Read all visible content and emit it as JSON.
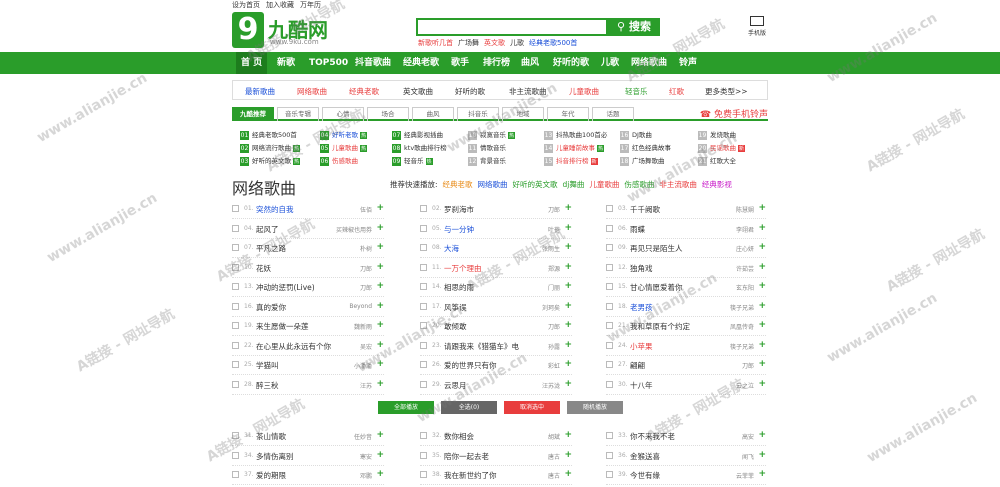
{
  "toplinks": [
    "设为首页",
    "加入收藏",
    "万年历"
  ],
  "logo": {
    "nine": "9",
    "name": "九酷网",
    "domain": "www.9ku.com"
  },
  "search": {
    "button": "搜索"
  },
  "hotwords": [
    "新歌听几首",
    "广场舞",
    "英文歌",
    "儿歌",
    "经典老歌500首"
  ],
  "pc_label": "手机版",
  "nav": [
    "首 页",
    "新歌",
    "TOP500",
    "抖音歌曲",
    "经典老歌",
    "歌手",
    "排行榜",
    "曲风",
    "好听的歌",
    "儿歌",
    "网络歌曲",
    "铃声"
  ],
  "subnav": [
    "最新歌曲",
    "网络歌曲",
    "经典老歌",
    "英文歌曲",
    "好听的歌",
    "非主流歌曲",
    "儿童歌曲",
    "轻音乐",
    "红歌",
    "更多类型>>"
  ],
  "tabs": [
    "九酷推荐",
    "音乐专辑",
    "心情",
    "场合",
    "曲风",
    "抖音乐",
    "地域",
    "年代",
    "话题"
  ],
  "ring": "免费手机铃声",
  "recs": [
    [
      "01",
      "经典老歌500首",
      ""
    ],
    [
      "04",
      "好听老歌",
      "热"
    ],
    [
      "07",
      "经典影视插曲",
      ""
    ],
    [
      "10",
      "寂寞音乐",
      "热"
    ],
    [
      "13",
      "抖热歌曲100首必",
      ""
    ],
    [
      "16",
      "DJ歌曲",
      ""
    ],
    [
      "19",
      "发烧歌曲",
      ""
    ],
    [
      "02",
      "网络流行歌曲",
      "热"
    ],
    [
      "05",
      "儿童歌曲",
      "热"
    ],
    [
      "08",
      "ktv歌曲排行榜",
      ""
    ],
    [
      "11",
      "情歌音乐",
      ""
    ],
    [
      "14",
      "儿童睡前故事",
      "热"
    ],
    [
      "17",
      "红色经典故事",
      ""
    ],
    [
      "20",
      "民谣歌曲",
      "新"
    ],
    [
      "03",
      "好听的英文歌",
      "热"
    ],
    [
      "06",
      "伤感歌曲",
      ""
    ],
    [
      "09",
      "轻音乐",
      "热"
    ],
    [
      "12",
      "背景音乐",
      ""
    ],
    [
      "15",
      "抖音排行榜",
      "新"
    ],
    [
      "18",
      "广场舞歌曲",
      ""
    ],
    [
      "21",
      "红歌大全",
      ""
    ]
  ],
  "section_title": "网络歌曲",
  "quick": [
    "推荐快速播放:",
    "经典老歌",
    "网络歌曲",
    "好听的英文歌",
    "dj舞曲",
    "儿童歌曲",
    "伤感歌曲",
    "非主流歌曲",
    "经典影视"
  ],
  "songs": [
    [
      "01.",
      "突然的自我",
      "伍佰"
    ],
    [
      "02.",
      "罗刹海市",
      "刀郎"
    ],
    [
      "03.",
      "千千阙歌",
      "陈慧娴"
    ],
    [
      "04.",
      "起风了",
      "买辣椒也用券"
    ],
    [
      "05.",
      "与一分钟",
      "叶蓓"
    ],
    [
      "06.",
      "雨蝶",
      "李翊君"
    ],
    [
      "07.",
      "平凡之路",
      "朴树"
    ],
    [
      "08.",
      "大海",
      "张雨生"
    ],
    [
      "09.",
      "再见只是陌生人",
      "庄心妍"
    ],
    [
      "10.",
      "花妖",
      "刀郎"
    ],
    [
      "11.",
      "一万个理由",
      "郑源"
    ],
    [
      "12.",
      "独角戏",
      "许茹芸"
    ],
    [
      "13.",
      "冲动的惩罚(Live)",
      "刀郎"
    ],
    [
      "14.",
      "相思的雨",
      "门丽"
    ],
    [
      "15.",
      "甘心情愿爱着你",
      "玄东阳"
    ],
    [
      "16.",
      "真的爱你",
      "Beyond"
    ],
    [
      "17.",
      "风筝误",
      "刘珂矣"
    ],
    [
      "18.",
      "老男孩",
      "筷子兄弟"
    ],
    [
      "19.",
      "来生愿做一朵莲",
      "魏新雨"
    ],
    [
      "20.",
      "敢倾敢",
      "刀郎"
    ],
    [
      "21.",
      "我和草原有个约定",
      "凤凰传奇"
    ],
    [
      "22.",
      "在心里从此永远有个你",
      "吴宏"
    ],
    [
      "23.",
      "请跟我来《猎猫车》电",
      "孙露"
    ],
    [
      "24.",
      "小苹果",
      "筷子兄弟"
    ],
    [
      "25.",
      "学猫叫",
      "小潘潘"
    ],
    [
      "26.",
      "爱的世界只有你",
      "彩虹"
    ],
    [
      "27.",
      "翩翩",
      "刀郎"
    ],
    [
      "28.",
      "醉三秋",
      "汪苏"
    ],
    [
      "29.",
      "云思月",
      "汪苏泷"
    ],
    [
      "30.",
      "十八年",
      "云之泣"
    ],
    [
      "31.",
      "茶山情歌",
      "任妙音"
    ],
    [
      "32.",
      "数你相会",
      "胡斌"
    ],
    [
      "33.",
      "你不来我不老",
      "高安"
    ],
    [
      "34.",
      "多情伤离别",
      "寒安"
    ],
    [
      "35.",
      "陪你一起去老",
      "唐古"
    ],
    [
      "36.",
      "金猴送喜",
      "闻飞"
    ],
    [
      "37.",
      "爱的期限",
      "邓鹏"
    ],
    [
      "38.",
      "我在新世约了你",
      "唐古"
    ],
    [
      "39.",
      "今世有缘",
      "云菲菲"
    ]
  ],
  "buttons": [
    "全部播放",
    "全选(0)",
    "取消选中",
    "随机播放"
  ],
  "watermark": [
    "A链接 - 网址导航",
    "www.alianjie.cn"
  ],
  "colors": {
    "green": "#2a9d2a",
    "red": "#e83d3d",
    "blue": "#1a4fd8"
  }
}
